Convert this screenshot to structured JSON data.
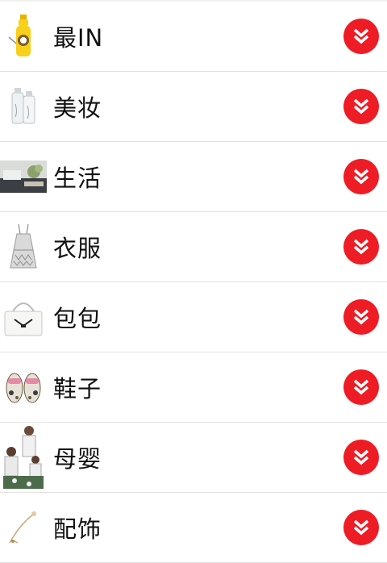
{
  "colors": {
    "accent": "#ee1c25",
    "divider": "#e2e2e2",
    "text": "#111111"
  },
  "categories": [
    {
      "label": "最IN",
      "thumbnail": "bottle"
    },
    {
      "label": "美妆",
      "thumbnail": "cosmetic-bottles"
    },
    {
      "label": "生活",
      "thumbnail": "living-room"
    },
    {
      "label": "衣服",
      "thumbnail": "dress"
    },
    {
      "label": "包包",
      "thumbnail": "handbag"
    },
    {
      "label": "鞋子",
      "thumbnail": "sandals"
    },
    {
      "label": "母婴",
      "thumbnail": "family"
    },
    {
      "label": "配饰",
      "thumbnail": "necklace"
    }
  ],
  "expand_icon": "double-chevron-down-icon"
}
